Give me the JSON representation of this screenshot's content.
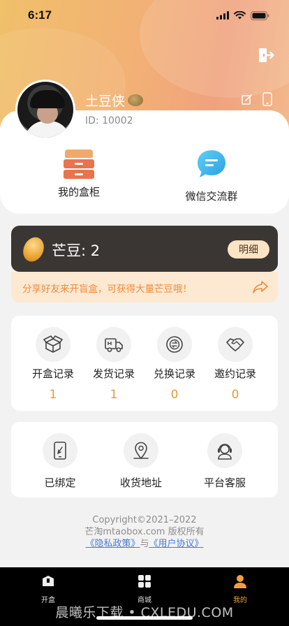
{
  "status_bar": {
    "time": "6:17"
  },
  "profile": {
    "username": "土豆侠",
    "user_id": "ID: 10002"
  },
  "quick_actions": [
    {
      "label": "我的盒柜",
      "icon": "box-cabinet-icon"
    },
    {
      "label": "微信交流群",
      "icon": "wechat-chat-icon"
    }
  ],
  "beans": {
    "label": "芒豆:",
    "value": "2",
    "detail_button": "明细"
  },
  "share": {
    "text": "分享好友来开盲盒，可获得大量芒豆哦！"
  },
  "records": [
    {
      "label": "开盒记录",
      "count": "1",
      "icon": "open-box-icon"
    },
    {
      "label": "发货记录",
      "count": "1",
      "icon": "delivery-truck-icon"
    },
    {
      "label": "兑换记录",
      "count": "0",
      "icon": "exchange-icon"
    },
    {
      "label": "邀约记录",
      "count": "0",
      "icon": "handshake-icon"
    }
  ],
  "services": [
    {
      "label": "已绑定",
      "icon": "bound-phone-icon"
    },
    {
      "label": "收货地址",
      "icon": "location-pin-icon"
    },
    {
      "label": "平台客服",
      "icon": "customer-service-icon"
    }
  ],
  "footer": {
    "copyright": "Copyright©2021–2022",
    "rights": "芒淘mtaobox.com 版权所有",
    "privacy_link": "《隐私政策》",
    "and": "与",
    "agreement_link": "《用户协议》"
  },
  "tabbar": [
    {
      "label": "开盒",
      "icon": "open-box-tab-icon",
      "active": false
    },
    {
      "label": "商城",
      "icon": "grid-tab-icon",
      "active": false
    },
    {
      "label": "我的",
      "icon": "profile-tab-icon",
      "active": true
    }
  ],
  "watermark": "晨曦乐下载 • CXLEDU.COM",
  "colors": {
    "accent": "#f0a23a",
    "count": "#e9993a",
    "dark_bar": "#3a3633",
    "share_bg": "#fde9d2",
    "link": "#4a7bd0"
  }
}
